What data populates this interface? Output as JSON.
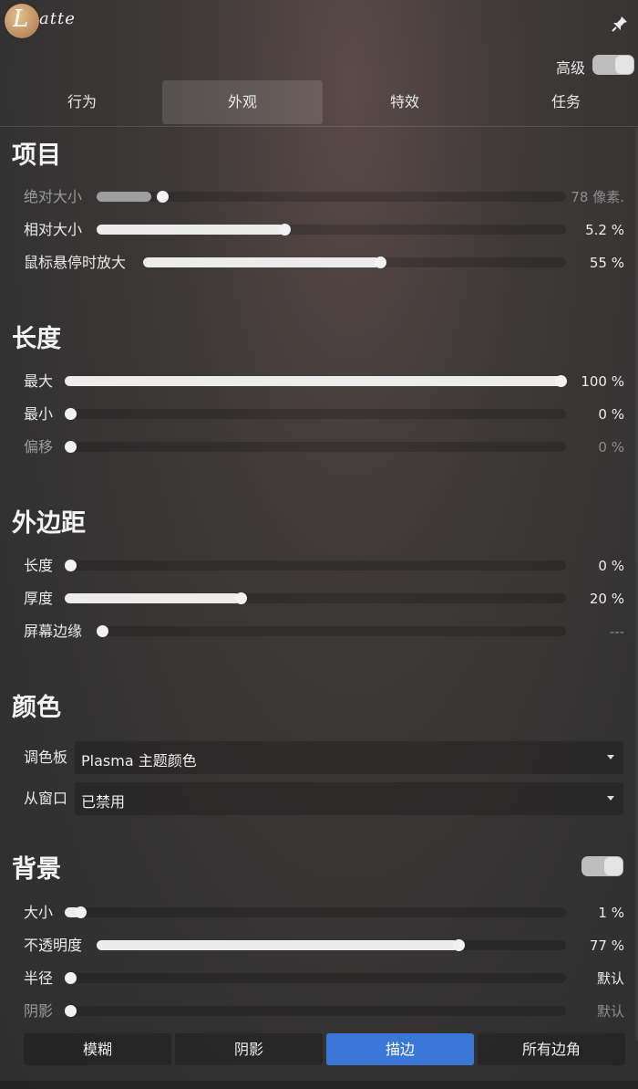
{
  "header": {
    "logo_letter": "L",
    "logo_text": "atte",
    "advanced_label": "高级"
  },
  "tabs": [
    {
      "label": "行为"
    },
    {
      "label": "外观"
    },
    {
      "label": "特效"
    },
    {
      "label": "任务"
    }
  ],
  "active_tab": "外观",
  "items": {
    "title": "项目",
    "rows": [
      {
        "label": "绝对大小",
        "value": "78 像素.",
        "level": 0.14,
        "disabled": true
      },
      {
        "label": "相对大小",
        "value": "5.2 %",
        "level": 0.4
      },
      {
        "label": "鼠标悬停时放大",
        "value": "55 %",
        "level": 0.56
      }
    ]
  },
  "length": {
    "title": "长度",
    "rows": [
      {
        "label": "最大",
        "value": "100 %",
        "level": 1.0
      },
      {
        "label": "最小",
        "value": "0 %",
        "level": 0.0
      },
      {
        "label": "偏移",
        "value": "0 %",
        "level": 0.0,
        "disabled": true
      }
    ]
  },
  "margins": {
    "title": "外边距",
    "rows": [
      {
        "label": "长度",
        "value": "0 %",
        "level": 0.0
      },
      {
        "label": "厚度",
        "value": "20 %",
        "level": 0.35
      },
      {
        "label": "屏幕边缘",
        "value": "---",
        "level": 0.0
      }
    ]
  },
  "colors": {
    "title": "颜色",
    "palette_label": "调色板",
    "palette_value": "Plasma 主题颜色",
    "from_window_label": "从窗口",
    "from_window_value": "已禁用"
  },
  "background": {
    "title": "背景",
    "enabled": true,
    "rows": [
      {
        "label": "大小",
        "value": "1 %",
        "level": 0.03
      },
      {
        "label": "不透明度",
        "value": "77 %",
        "level": 0.77
      },
      {
        "label": "半径",
        "value": "默认",
        "level": 0.0
      },
      {
        "label": "阴影",
        "value": "默认",
        "level": 0.0,
        "disabled": true
      }
    ]
  },
  "bottom_buttons": [
    {
      "label": "模糊"
    },
    {
      "label": "阴影"
    },
    {
      "label": "描边"
    },
    {
      "label": "所有边角"
    }
  ],
  "active_bottom_button": "描边",
  "accent_color": "#3a77d6"
}
